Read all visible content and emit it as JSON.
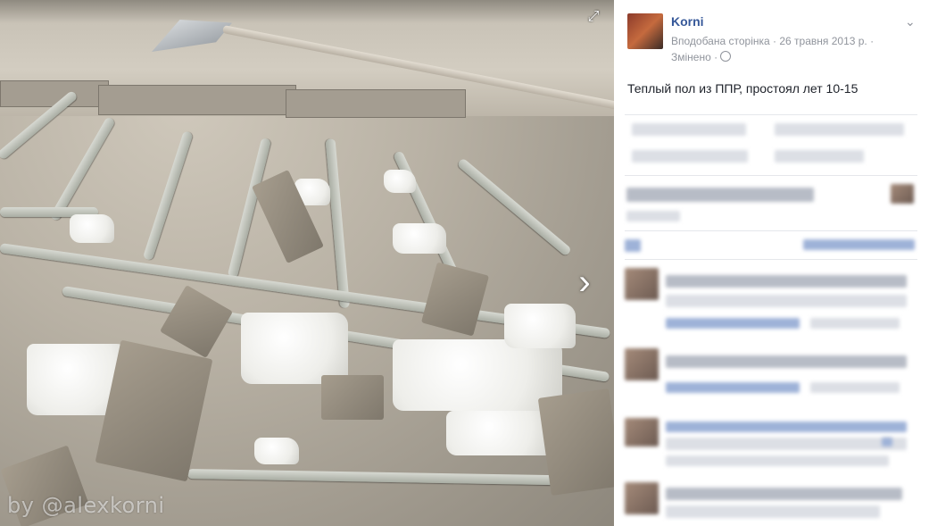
{
  "photo": {
    "watermark": "by @alexkorni",
    "expand_icon": "expand-icon",
    "next_icon": "chevron-right-icon"
  },
  "post": {
    "page_name": "Korni",
    "meta_liked": "Вподобана сторінка",
    "meta_date": "26 травня 2013 р.",
    "meta_edited": "Змінено",
    "privacy_icon": "globe-icon",
    "text": "Теплый пол из ППР, простоял лет 10-15",
    "options_icon": "chevron-down-icon"
  },
  "colors": {
    "link": "#365899",
    "meta": "#90949c",
    "text": "#1d2129"
  }
}
